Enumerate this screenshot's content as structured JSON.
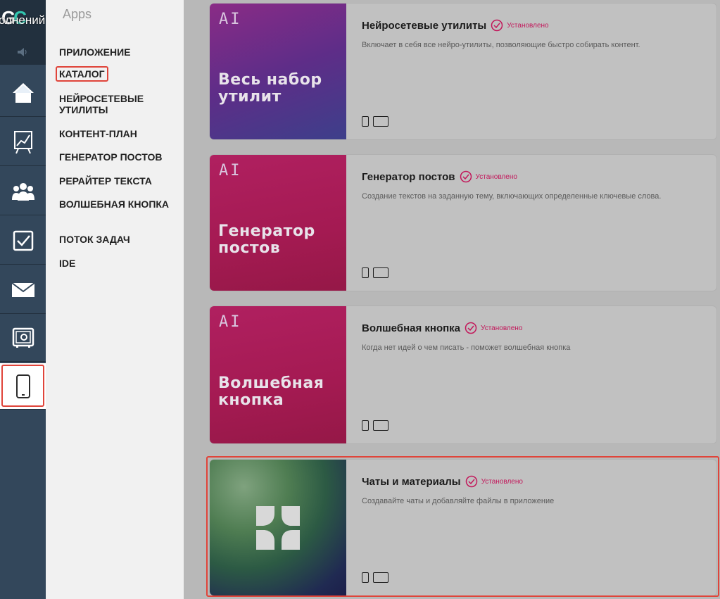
{
  "rail": {
    "logo": "GC",
    "overlay_text": "олнений",
    "items": [
      {
        "name": "home-icon"
      },
      {
        "name": "chart-icon"
      },
      {
        "name": "users-icon"
      },
      {
        "name": "tasks-icon"
      },
      {
        "name": "mail-icon"
      },
      {
        "name": "safe-icon"
      },
      {
        "name": "mobile-icon"
      }
    ]
  },
  "subnav": {
    "title": "Apps",
    "items": [
      {
        "label": "ПРИЛОЖЕНИЕ"
      },
      {
        "label": "КАТАЛОГ",
        "selected": true
      },
      {
        "label": "НЕЙРОСЕТЕВЫЕ УТИЛИТЫ"
      },
      {
        "label": "КОНТЕНТ-ПЛАН"
      },
      {
        "label": "ГЕНЕРАТОР ПОСТОВ"
      },
      {
        "label": "РЕРАЙТЕР ТЕКСТА"
      },
      {
        "label": "ВОЛШЕБНАЯ КНОПКА"
      },
      {
        "label": "ПОТОК ЗАДАЧ"
      },
      {
        "label": "IDE"
      }
    ]
  },
  "catalog": {
    "cards": [
      {
        "badge": "AI",
        "cover_text": "Весь набор утилит",
        "title": "Нейросетевые утилиты",
        "status": "Установлено",
        "description": "Включает в себя все нейро-утилиты, позволяющие быстро собирать контент."
      },
      {
        "badge": "AI",
        "cover_text": "Генератор постов",
        "title": "Генератор постов",
        "status": "Установлено",
        "description": "Создание текстов на заданную тему, включающих определенные ключевые слова."
      },
      {
        "badge": "AI",
        "cover_text": "Волшебная кнопка",
        "title": "Волшебная кнопка",
        "status": "Установлено",
        "description": "Когда нет идей о чем писать - поможет волшебная кнопка"
      },
      {
        "badge": "",
        "cover_text": "",
        "title": "Чаты и материалы",
        "status": "Установлено",
        "description": "Создавайте чаты и добавляйте файлы в приложение"
      }
    ]
  },
  "colors": {
    "accent_status": "#c2185b",
    "highlight": "#e0443a",
    "rail_bg": "#33475b",
    "logo_accent": "#32c7b0"
  }
}
